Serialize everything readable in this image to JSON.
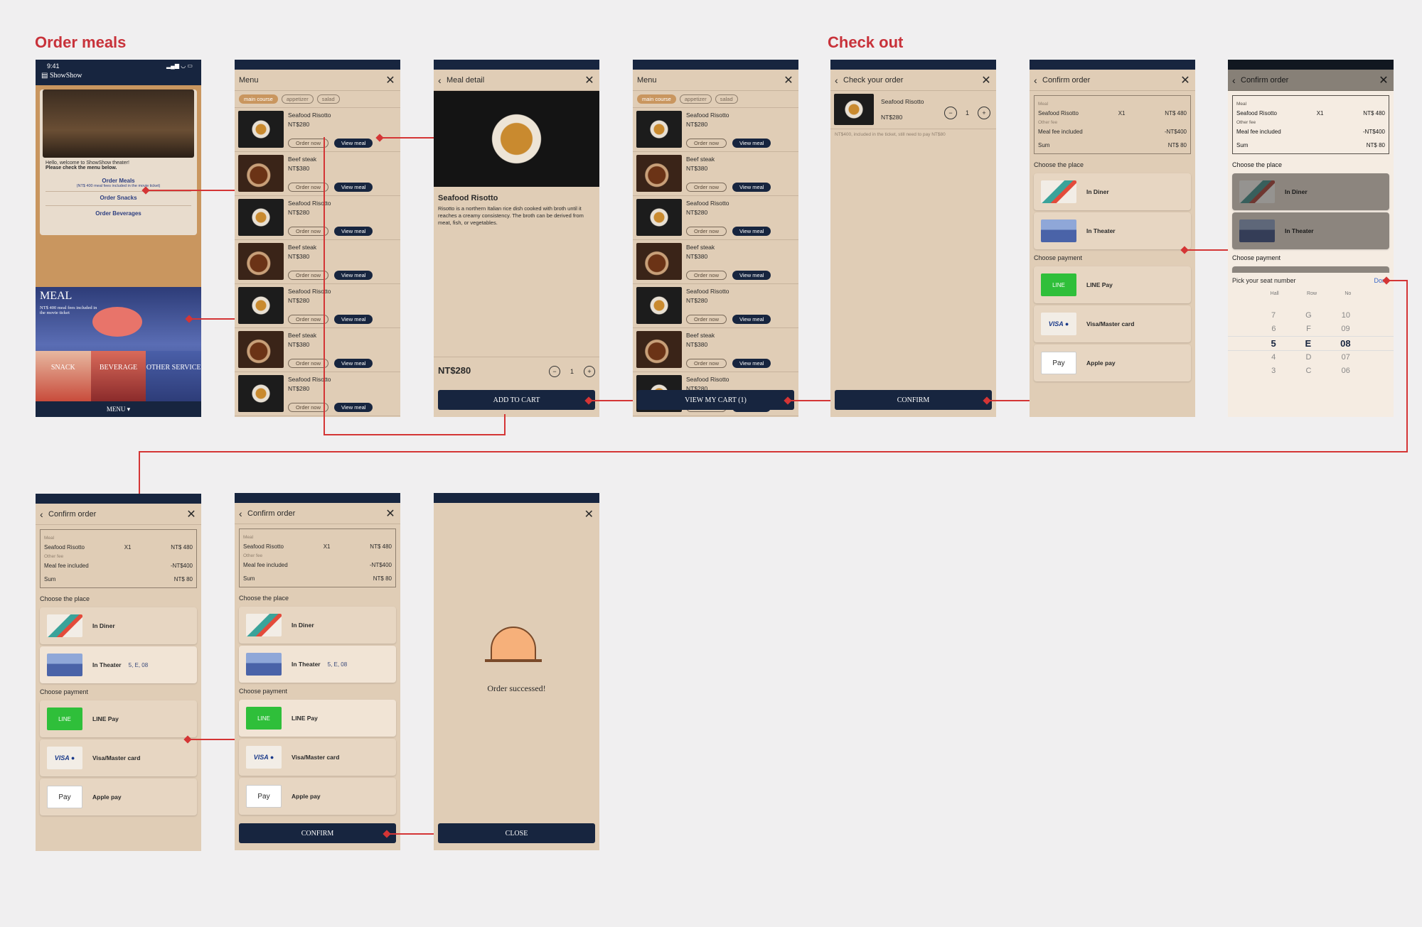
{
  "sections": {
    "order_meals": "Order meals",
    "check_out": "Check out"
  },
  "home": {
    "time": "9:41",
    "brand": "ShowShow",
    "welcome": "Hello, welcome to ShowShow theater!",
    "welcome_bold": "Please check the menu below.",
    "order_meals": "Order Meals",
    "order_meals_note": "(NT$ 400 meal fees included in the movie ticket)",
    "order_snacks": "Order Snacks",
    "order_beverages": "Order Beverages",
    "meal_title": "MEAL",
    "meal_sub": "NT$ 400 meal fees included in the movie ticket",
    "cats": [
      "SNACK",
      "BEVERAGE",
      "OTHER SERVICE"
    ],
    "menu_label": "MENU"
  },
  "menu": {
    "title": "Menu",
    "tags": [
      "main course",
      "appetizer",
      "salad"
    ],
    "items": [
      {
        "name": "Seafood Risotto",
        "price": "NT$280"
      },
      {
        "name": "Beef steak",
        "price": "NT$380"
      },
      {
        "name": "Seafood Risotto",
        "price": "NT$280"
      },
      {
        "name": "Beef steak",
        "price": "NT$380"
      },
      {
        "name": "Seafood Risotto",
        "price": "NT$280"
      },
      {
        "name": "Beef steak",
        "price": "NT$380"
      },
      {
        "name": "Seafood Risotto",
        "price": "NT$280"
      }
    ],
    "order_now": "Order now",
    "view_meal": "View meal",
    "view_cart": "VIEW MY CART (1)"
  },
  "detail": {
    "title": "Meal detail",
    "name": "Seafood Risotto",
    "desc": "Risotto is a northern Italian rice dish cooked with broth until it reaches a creamy consistency. The broth can be derived from meat, fish, or vegetables.",
    "price": "NT$280",
    "qty": "1",
    "add": "ADD TO CART"
  },
  "checkorder": {
    "title": "Check your order",
    "item": "Seafood Risotto",
    "price": "NT$280",
    "qty": "1",
    "note": "NT$400, included in the ticket, still need to pay NT$80",
    "confirm": "CONFIRM"
  },
  "confirm": {
    "title": "Confirm order",
    "meal_lbl": "Meal",
    "item": "Seafood Risotto",
    "qty": "X1",
    "item_price": "NT$ 480",
    "other_lbl": "Other fee",
    "fee_lbl": "Meal fee included",
    "fee": "-NT$400",
    "sum_lbl": "Sum",
    "sum": "NT$ 80",
    "place_lbl": "Choose the place",
    "diner": "In Diner",
    "theater": "In Theater",
    "seat": "5, E, 08",
    "pay_lbl": "Choose payment",
    "line": "LINE Pay",
    "visa": "Visa/Master card",
    "apple": "Apple pay",
    "confirm": "CONFIRM"
  },
  "seat": {
    "title": "Pick your seat number",
    "done": "Done",
    "cols": [
      "Hall",
      "Row",
      "No"
    ],
    "rows": [
      [
        "7",
        "G",
        "10"
      ],
      [
        "6",
        "F",
        "09"
      ],
      [
        "5",
        "E",
        "08"
      ],
      [
        "4",
        "D",
        "07"
      ],
      [
        "3",
        "C",
        "06"
      ]
    ]
  },
  "success": {
    "msg": "Order successed!",
    "close": "CLOSE"
  },
  "colors": {
    "accent": "#c8323a",
    "navy": "#17253f",
    "tan": "#e0cdb6"
  }
}
